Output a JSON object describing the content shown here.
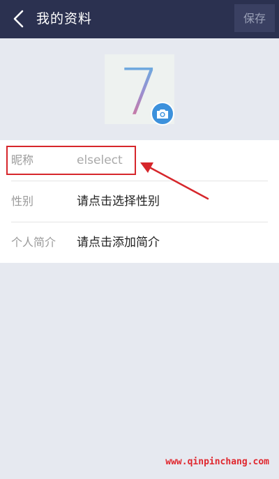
{
  "header": {
    "title": "我的资料",
    "save_label": "保存"
  },
  "avatar": {
    "glyph": "7"
  },
  "profile_rows": [
    {
      "label": "昵称",
      "value": "elselect"
    },
    {
      "label": "性别",
      "value": "请点击选择性别"
    },
    {
      "label": "个人简介",
      "value": "请点击添加简介"
    }
  ],
  "watermark": "www.qinpinchang.com",
  "colors": {
    "header_bg": "#2b3150",
    "page_bg": "#e6e9f0",
    "camera_accent": "#3c91dc",
    "annotation_red": "#d6262b"
  },
  "icons": {
    "back": "chevron-left-icon",
    "camera": "camera-icon"
  }
}
